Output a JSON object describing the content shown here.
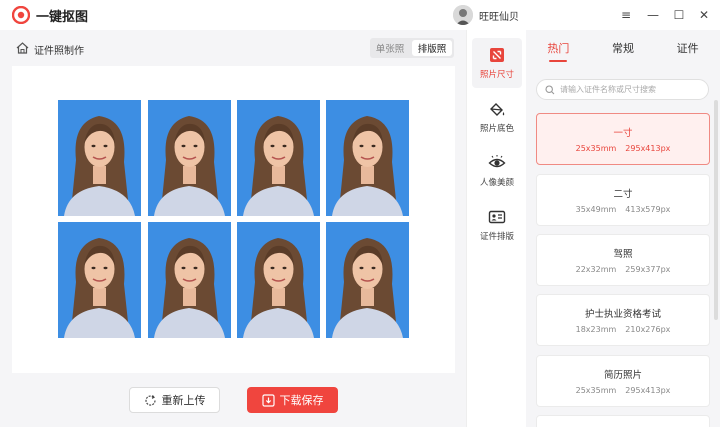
{
  "app": {
    "title": "一键抠图",
    "username": "旺旺仙贝",
    "accent": "#e8453c",
    "photo_bg": "#3d8ee3"
  },
  "window_controls": {
    "menu": "≡",
    "minimize": "—",
    "maximize": "☐",
    "close": "✕"
  },
  "breadcrumb": "证件照制作",
  "mode_toggle": {
    "single": "单张照",
    "layout": "排版照"
  },
  "actions": {
    "reupload": "重新上传",
    "save": "下载保存"
  },
  "toolbar": [
    {
      "label": "照片尺寸",
      "icon": "crop-icon",
      "active": true
    },
    {
      "label": "照片底色",
      "icon": "paint-bucket-icon",
      "active": false
    },
    {
      "label": "人像美颜",
      "icon": "eye-icon",
      "active": false
    },
    {
      "label": "证件排版",
      "icon": "id-card-icon",
      "active": false
    }
  ],
  "tabs": [
    {
      "label": "热门",
      "active": true
    },
    {
      "label": "常规",
      "active": false
    },
    {
      "label": "证件",
      "active": false
    }
  ],
  "search": {
    "placeholder": "请输入证件名称或尺寸搜索",
    "value": ""
  },
  "sizes": [
    {
      "name": "一寸",
      "mm": "25x35mm",
      "px": "295x413px",
      "selected": true
    },
    {
      "name": "二寸",
      "mm": "35x49mm",
      "px": "413x579px",
      "selected": false
    },
    {
      "name": "驾照",
      "mm": "22x32mm",
      "px": "259x377px",
      "selected": false
    },
    {
      "name": "护士执业资格考试",
      "mm": "18x23mm",
      "px": "210x276px",
      "selected": false
    },
    {
      "name": "简历照片",
      "mm": "25x35mm",
      "px": "295x413px",
      "selected": false
    }
  ]
}
